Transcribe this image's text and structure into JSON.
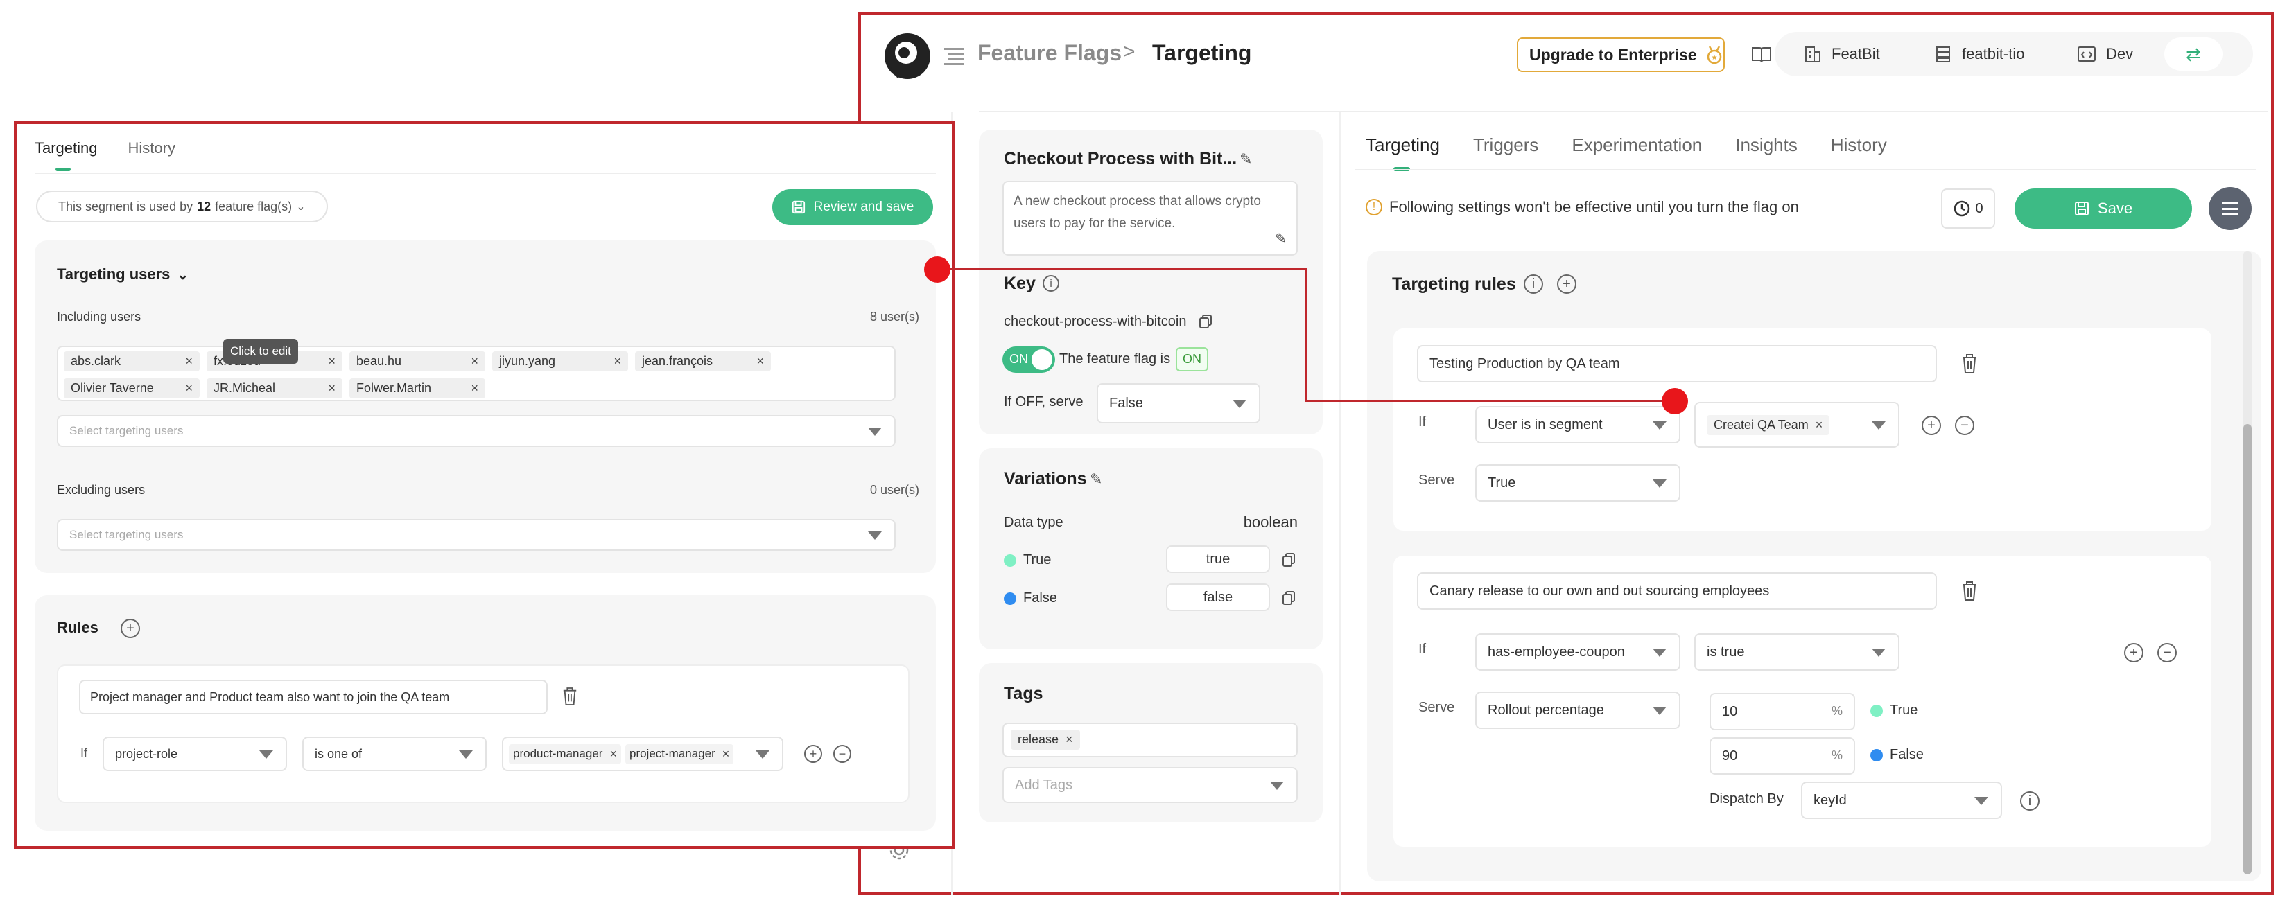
{
  "header": {
    "breadcrumb_parent": "Feature Flags",
    "breadcrumb_sep": ">",
    "breadcrumb_current": "Targeting",
    "upgrade_label": "Upgrade to Enterprise",
    "org": "FeatBit",
    "project": "featbit-tio",
    "env": "Dev"
  },
  "flag": {
    "name": "Checkout Process with Bit...",
    "description": "A new checkout process that allows crypto users to pay for the service.",
    "key_title": "Key",
    "key_value": "checkout-process-with-bitcoin",
    "toggle_label": "ON",
    "status_text": "The feature flag is",
    "status_badge": "ON",
    "off_serve_label": "If OFF, serve",
    "off_serve_value": "False"
  },
  "variations": {
    "title": "Variations",
    "data_type_label": "Data type",
    "data_type_value": "boolean",
    "items": [
      {
        "name": "True",
        "value": "true",
        "color": "#7ff0c4"
      },
      {
        "name": "False",
        "value": "false",
        "color": "#2f8cf0"
      }
    ]
  },
  "tags": {
    "title": "Tags",
    "items": [
      "release"
    ],
    "placeholder": "Add Tags"
  },
  "main_tabs": [
    "Targeting",
    "Triggers",
    "Experimentation",
    "Insights",
    "History"
  ],
  "warning": "Following settings won't be effective until you turn the flag on",
  "history_count": "0",
  "save_label": "Save",
  "targeting_rules": {
    "title": "Targeting rules",
    "rules": [
      {
        "name": "Testing Production by QA team",
        "if_label": "If",
        "property": "User is in segment",
        "segment": "Createi QA Team",
        "serve_label": "Serve",
        "serve": "True"
      },
      {
        "name": "Canary release to our own and out sourcing employees",
        "if_label": "If",
        "property": "has-employee-coupon",
        "operator": "is true",
        "serve_label": "Serve",
        "serve": "Rollout percentage",
        "rollout": [
          {
            "percent": "10",
            "unit": "%",
            "variation": "True",
            "color": "#7ff0c4"
          },
          {
            "percent": "90",
            "unit": "%",
            "variation": "False",
            "color": "#2f8cf0"
          }
        ],
        "dispatch_label": "Dispatch By",
        "dispatch_value": "keyId"
      }
    ]
  },
  "segment": {
    "tabs": [
      "Targeting",
      "History"
    ],
    "usage_prefix": "This segment is used by",
    "usage_count": "12",
    "usage_suffix": "feature flag(s)",
    "review_label": "Review and save",
    "targeting_users_title": "Targeting users",
    "including_label": "Including users",
    "including_count": "8 user(s)",
    "included_users": [
      "abs.clark",
      "fx.ouzou",
      "beau.hu",
      "jiyun.yang",
      "jean.françois",
      "Olivier Taverne",
      "JR.Micheal",
      "Folwer.Martin"
    ],
    "tooltip": "Click to edit",
    "select_placeholder": "Select targeting users",
    "excluding_label": "Excluding users",
    "excluding_count": "0 user(s)",
    "rules_title": "Rules",
    "rule_name": "Project manager and Product team also want to join the QA team",
    "rule_if": "If",
    "rule_property": "project-role",
    "rule_operator": "is one of",
    "rule_values": [
      "product-manager",
      "project-manager"
    ]
  },
  "colors": {
    "accent": "#3dbb85",
    "frame": "#c0272d",
    "connector_dot": "#e8161b"
  }
}
